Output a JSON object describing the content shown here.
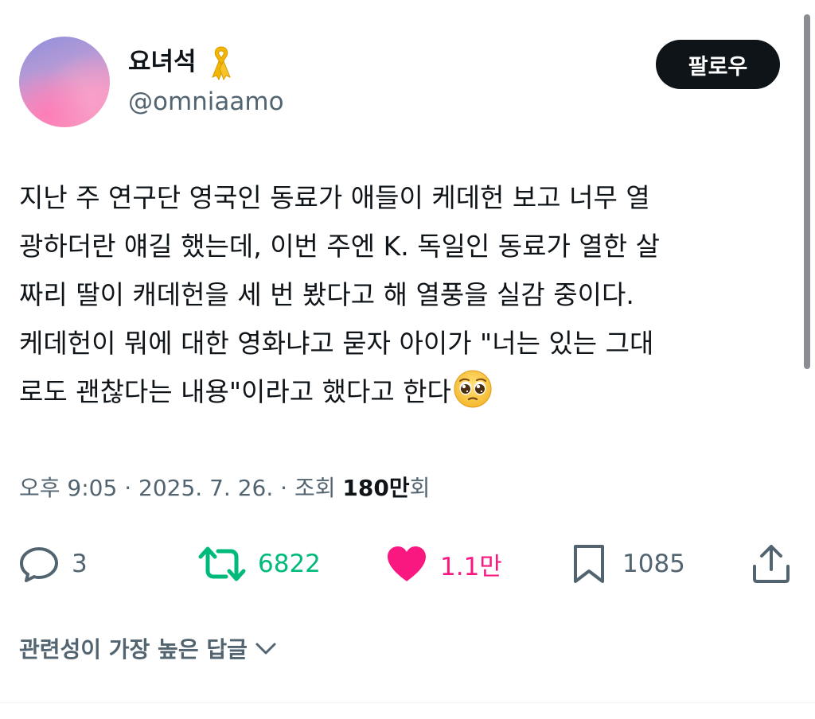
{
  "user": {
    "display_name": "요녀석",
    "badge_icon": "yellow-ribbon-icon",
    "handle": "@omniaamo",
    "follow_label": "팔로우"
  },
  "tweet": {
    "lines": [
      "지난 주 연구단 영국인 동료가 애들이 케데헌 보고 너무 열",
      "광하더란 얘길 했는데, 이번 주엔 K. 독일인 동료가 열한 살",
      "짜리 딸이 캐데헌을 세 번 봤다고 해 열풍을 실감 중이다.",
      "케데헌이 뭐에 대한 영화냐고 묻자 아이가 \"너는 있는 그대",
      "로도 괜찮다는 내용\"이라고 했다고 한다"
    ],
    "trailing_emoji": "pleading-face-emoji"
  },
  "meta": {
    "time": "오후 9:05",
    "date": "2025. 7. 26.",
    "separator": "·",
    "views_prefix": "조회",
    "views_count": "180만",
    "views_suffix": "회"
  },
  "actions": {
    "reply": {
      "icon": "reply-icon",
      "count": "3"
    },
    "retweet": {
      "icon": "retweet-icon",
      "count": "6822"
    },
    "like": {
      "icon": "heart-icon",
      "count": "1.1만"
    },
    "bookmark": {
      "icon": "bookmark-icon",
      "count": "1085"
    },
    "share": {
      "icon": "share-icon"
    }
  },
  "replies_sort": {
    "label": "관련성이 가장 높은 답글",
    "icon": "chevron-down-icon"
  },
  "colors": {
    "text_primary": "#0f1419",
    "text_secondary": "#536471",
    "retweet_green": "#00ba7c",
    "like_pink": "#f91880",
    "follow_button_bg": "#0f1419"
  }
}
